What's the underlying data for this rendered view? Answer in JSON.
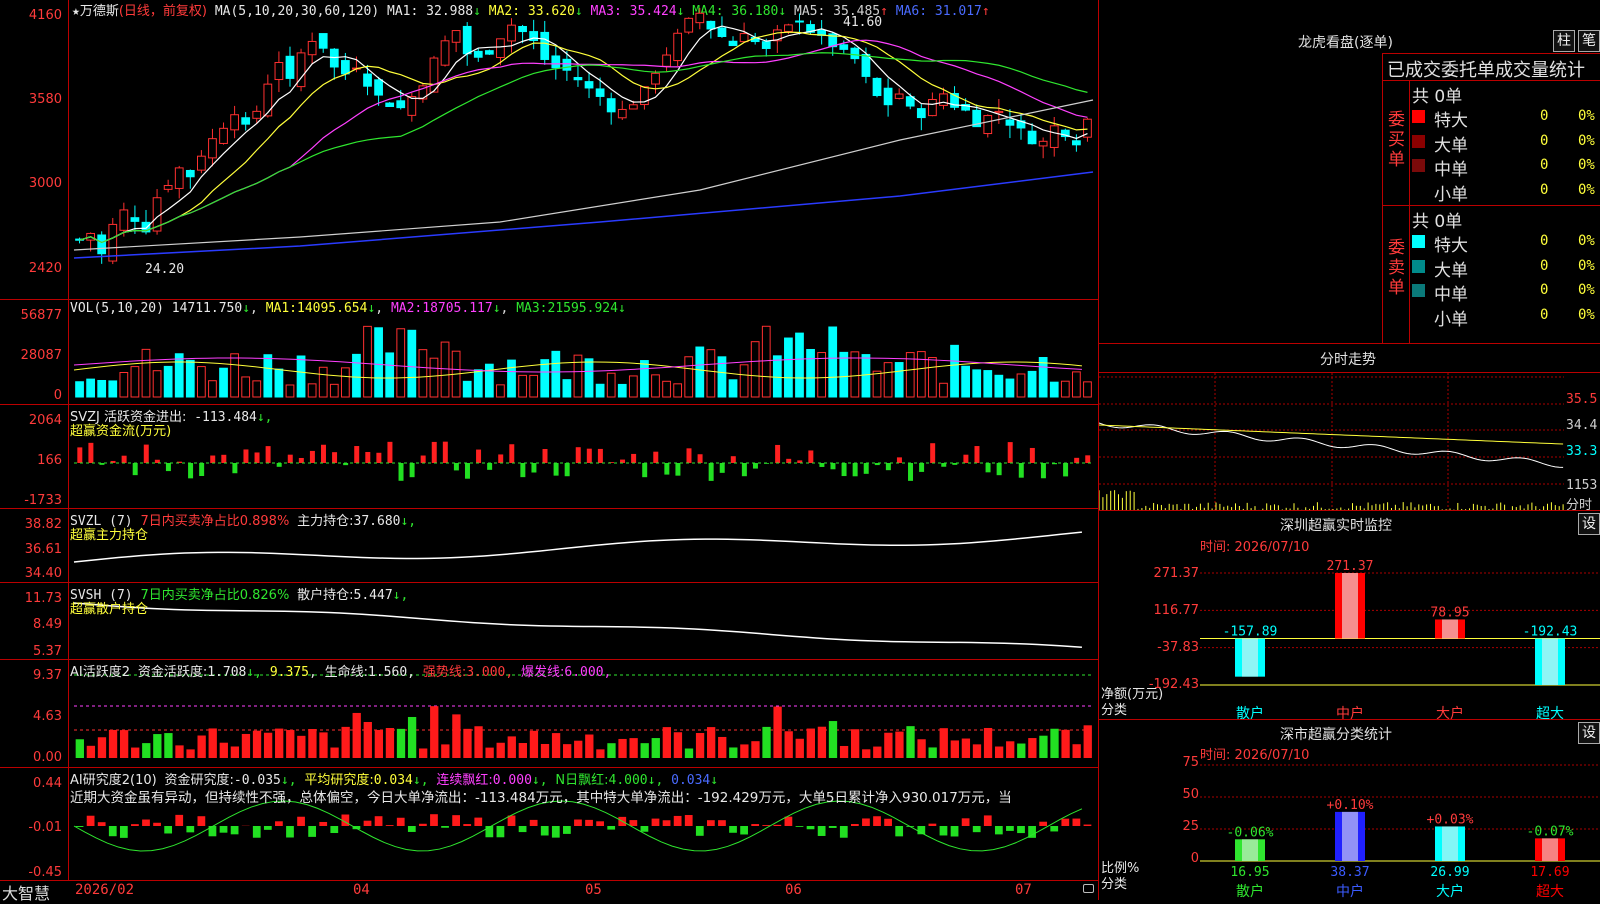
{
  "main": {
    "title_star": "★",
    "stock_name": "万德斯",
    "period": "(日线，前复权)",
    "ma_params": "MA(5,10,20,30,60,120)",
    "ma": [
      {
        "label": "MA1:",
        "value": "32.988",
        "arrow": "↓",
        "color": "#e8e8e8"
      },
      {
        "label": "MA2:",
        "value": "33.620",
        "arrow": "↓",
        "color": "#ffff3b"
      },
      {
        "label": "MA3:",
        "value": "35.424",
        "arrow": "↓",
        "color": "#ff40ff"
      },
      {
        "label": "MA4:",
        "value": "36.180",
        "arrow": "↓",
        "color": "#2fe62f"
      },
      {
        "label": "MA5:",
        "value": "35.485",
        "arrow": "↑",
        "color": "#cfcfcf"
      },
      {
        "label": "MA6:",
        "value": "31.017",
        "arrow": "↑",
        "color": "#4a6bff"
      }
    ],
    "price_axis": [
      "4160",
      "3580",
      "3000",
      "2420"
    ],
    "high_marker": "41.60",
    "low_marker": "24.20"
  },
  "volume": {
    "header": "VOL(5,10,20)",
    "value": "14711.750",
    "arrow": "↓",
    "ma": [
      {
        "label": "MA1:",
        "value": "14095.654",
        "arrow": "↓"
      },
      {
        "label": "MA2:",
        "value": "18705.117",
        "arrow": "↓"
      },
      {
        "label": "MA3:",
        "value": "21595.924",
        "arrow": "↓"
      }
    ],
    "axis": [
      "56877",
      "28087",
      "0"
    ]
  },
  "svzj": {
    "header": "SVZJ  活跃资金进出:",
    "value": "-113.484",
    "arrow": "↓,",
    "subtitle": "超赢资金流(万元)",
    "axis": [
      "2064",
      "166",
      "-1733"
    ]
  },
  "svzl": {
    "header": "SVZL (7)",
    "ratio_text": "7日内买卖净占比0.898%",
    "hold_label": "主力持仓:",
    "hold_value": "37.680",
    "arrow": "↓,",
    "subtitle": "超赢主力持仓",
    "axis": [
      "38.82",
      "36.61",
      "34.40"
    ]
  },
  "svsh": {
    "header": "SVSH (7)",
    "ratio_text": "7日内买卖净占比0.826%",
    "hold_label": "散户持仓:",
    "hold_value": "5.447",
    "arrow": "↓,",
    "subtitle": "超赢散户持仓",
    "axis": [
      "11.73",
      "8.49",
      "5.37"
    ]
  },
  "ai_activity": {
    "header": "AI活跃度2",
    "act_label": "资金活跃度:",
    "act_value": "1.708",
    "act_arrow": "↓,",
    "act_value2": "9.375",
    "life_label": "生命线:",
    "life_value": "1.560,",
    "strong_label": "强势线:",
    "strong_value": "3.000,",
    "burst_label": "爆发线:",
    "burst_value": "6.000,",
    "axis": [
      "9.37",
      "4.63",
      "0.00"
    ]
  },
  "ai_research": {
    "header": "AI研究度2(10)",
    "res_label": "资金研究度:",
    "res_value": "-0.035",
    "res_arrow": "↓,",
    "avg_label": "平均研究度:",
    "avg_value": "0.034",
    "avg_arrow": "↓,",
    "cont_label": "连续飘红:",
    "cont_value": "0.000",
    "cont_arrow": "↓,",
    "n_label": "N日飘红:",
    "n_value": "4.000",
    "n_arrow": "↓,",
    "last_value": "0.034",
    "last_arrow": "↓",
    "commentary": "近期大资金虽有异动，但持续性不强，总体偏空，今日大单净流出：-113.484万元，其中特大单净流出：-192.429万元，大单5日累计净入930.017万元，当",
    "axis": [
      "0.44",
      "-0.01",
      "-0.45"
    ]
  },
  "timeline": {
    "brand": "大智慧",
    "labels": [
      "2026/02",
      "04",
      "05",
      "06",
      "07"
    ]
  },
  "right_panel": {
    "lhb_title": "龙虎看盘(逐单)",
    "btn_zhu": "柱",
    "btn_bi": "笔",
    "tabs_row": "已成交委托单成交量统计",
    "buy": {
      "side_label": "委买单",
      "total": "共 0单",
      "rows": [
        {
          "name": "特大",
          "count": "0",
          "pct": "0%",
          "color": "#ff0000"
        },
        {
          "name": "大单",
          "count": "0",
          "pct": "0%",
          "color": "#8b0000"
        },
        {
          "name": "中单",
          "count": "0",
          "pct": "0%",
          "color": "#7a0a0a"
        },
        {
          "name": "小单",
          "count": "0",
          "pct": "0%",
          "color": "#000000"
        }
      ]
    },
    "sell": {
      "side_label": "委卖单",
      "total": "共 0单",
      "rows": [
        {
          "name": "特大",
          "count": "0",
          "pct": "0%",
          "color": "#00ffff"
        },
        {
          "name": "大单",
          "count": "0",
          "pct": "0%",
          "color": "#008b8b"
        },
        {
          "name": "中单",
          "count": "0",
          "pct": "0%",
          "color": "#0a7a7a"
        },
        {
          "name": "小单",
          "count": "0",
          "pct": "0%",
          "color": "#000000"
        }
      ]
    },
    "intraday_title": "分时走势",
    "intraday_axis": [
      "35.5",
      "34.4",
      "33.3",
      "1153",
      "分时"
    ],
    "sz_monitor_title": "深圳超赢实时监控",
    "sz_monitor_btn": "设",
    "sz_monitor_time": "时间: 2026/07/10",
    "sz_axis": [
      "271.37",
      "116.77",
      "-37.83",
      "-192.43"
    ],
    "sz_y_label": "净额(万元)",
    "sz_x_label": "分类",
    "sz_bars": [
      {
        "cat": "散户",
        "value": -157.89,
        "label": "-157.89",
        "color": "#00ffff"
      },
      {
        "cat": "中户",
        "value": 271.37,
        "label": "271.37",
        "color": "#ff0000"
      },
      {
        "cat": "大户",
        "value": 78.95,
        "label": "78.95",
        "color": "#ff0000"
      },
      {
        "cat": "超大",
        "value": -192.43,
        "label": "-192.43",
        "color": "#00ffff"
      }
    ],
    "dist_title": "深市超赢分类统计",
    "dist_btn": "设",
    "dist_time": "时间: 2026/07/10",
    "dist_axis": [
      "75",
      "50",
      "25",
      "0"
    ],
    "dist_y_label": "比例%",
    "dist_x_label": "分类",
    "dist_bars": [
      {
        "cat": "散户",
        "value": 16.95,
        "bottom": "16.95",
        "delta": "-0.06%",
        "color": "#2fe62f"
      },
      {
        "cat": "中户",
        "value": 38.37,
        "bottom": "38.37",
        "delta": "+0.10%",
        "color": "#2020ff"
      },
      {
        "cat": "大户",
        "value": 26.99,
        "bottom": "26.99",
        "delta": "+0.03%",
        "color": "#00ffff"
      },
      {
        "cat": "超大",
        "value": 17.69,
        "bottom": "17.69",
        "delta": "-0.07%",
        "color": "#ff0000"
      }
    ]
  },
  "chart_data": {
    "type": "bar",
    "title": "深圳超赢实时监控",
    "categories": [
      "散户",
      "中户",
      "大户",
      "超大"
    ],
    "values": [
      -157.89,
      271.37,
      78.95,
      -192.43
    ],
    "ylabel": "净额(万元)",
    "ylim": [
      -192.43,
      271.37
    ]
  }
}
